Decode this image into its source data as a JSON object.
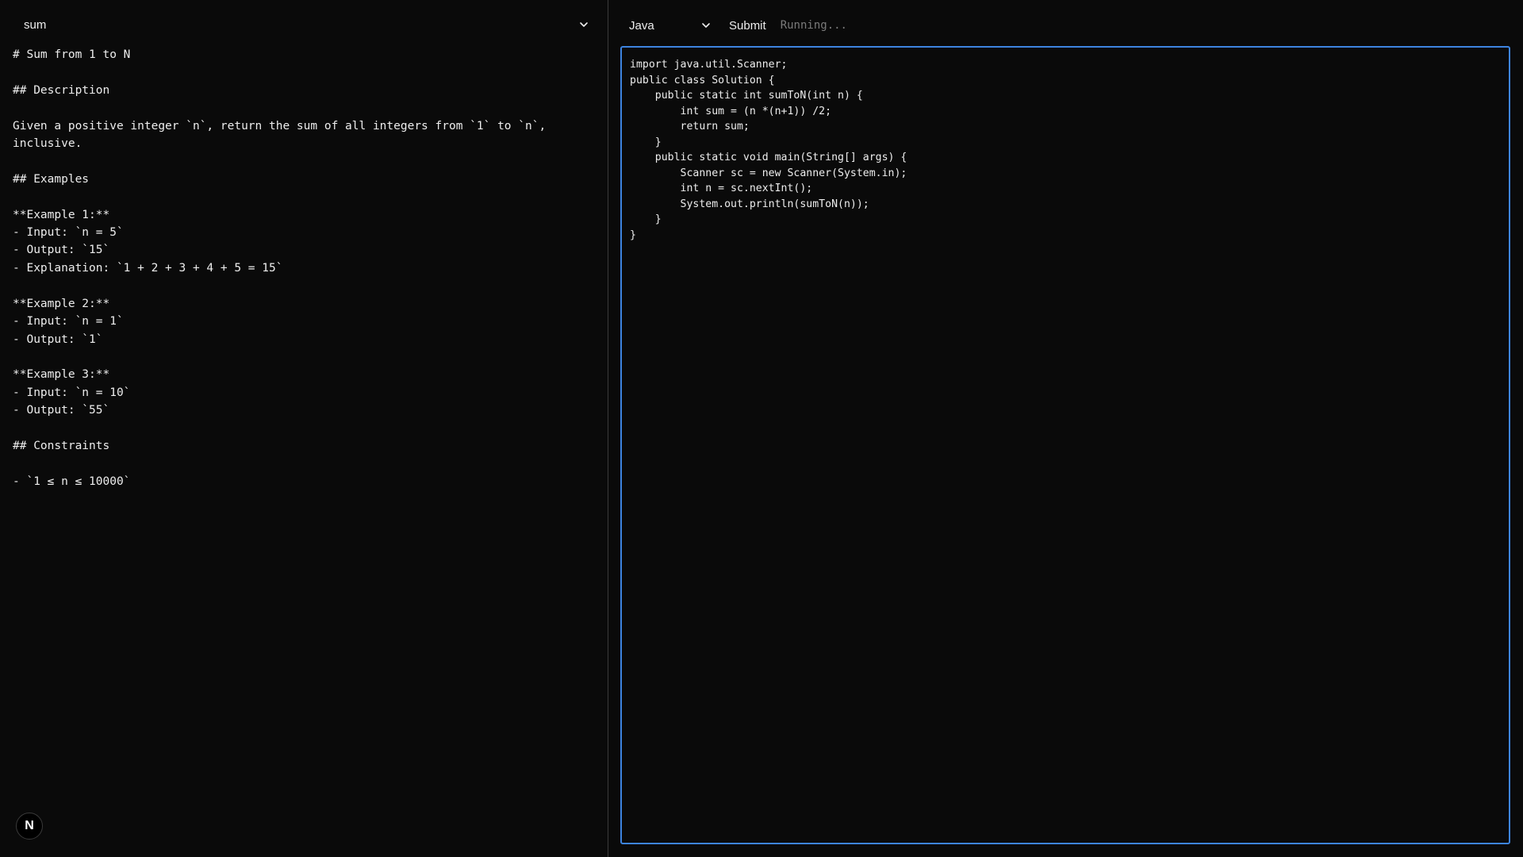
{
  "problem_select": {
    "value": "sum",
    "icon": "chevron-down-icon"
  },
  "problem_text": "# Sum from 1 to N\n\n## Description\n\nGiven a positive integer `n`, return the sum of all integers from `1` to `n`,\ninclusive.\n\n## Examples\n\n**Example 1:**\n- Input: `n = 5`\n- Output: `15`\n- Explanation: `1 + 2 + 3 + 4 + 5 = 15`\n\n**Example 2:**\n- Input: `n = 1`\n- Output: `1`\n\n**Example 3:**\n- Input: `n = 10`\n- Output: `55`\n\n## Constraints\n\n- `1 ≤ n ≤ 10000`",
  "logo": {
    "letter": "N"
  },
  "toolbar": {
    "language": "Java",
    "submit_label": "Submit",
    "status": "Running..."
  },
  "editor": {
    "code": "import java.util.Scanner;\npublic class Solution {\n    public static int sumToN(int n) {\n        int sum = (n *(n+1)) /2;\n        return sum;\n    }\n    public static void main(String[] args) {\n        Scanner sc = new Scanner(System.in);\n        int n = sc.nextInt();\n        System.out.println(sumToN(n));\n    }\n}"
  },
  "colors": {
    "background": "#0a0a0a",
    "text": "#ededed",
    "muted": "#7a7a7a",
    "editor_border": "#3d84e0",
    "divider": "#3a3a3a"
  }
}
